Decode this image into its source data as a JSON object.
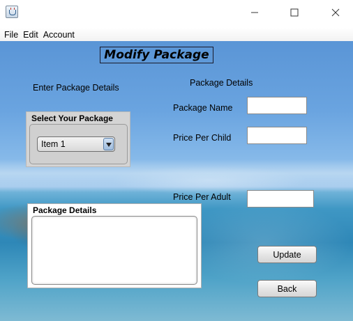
{
  "window": {
    "app_icon": "java-cup-icon",
    "controls": [
      "minimize-icon",
      "maximize-icon",
      "close-icon"
    ]
  },
  "menu": {
    "items": [
      "File",
      "Edit",
      "Account"
    ]
  },
  "form": {
    "title": "Modify Package",
    "enter_label": "Enter Package Details",
    "details_heading": "Package Details",
    "select_panel_title": "Select Your Package",
    "select_value": "Item 1",
    "package_name_label": "Package Name",
    "package_name_value": "",
    "price_child_label": "Price Per Child",
    "price_child_value": "",
    "price_adult_label": "Price Per Adult",
    "price_adult_value": "",
    "details_panel_title": "Package Details",
    "details_text": "",
    "update_button": "Update",
    "back_button": "Back"
  }
}
